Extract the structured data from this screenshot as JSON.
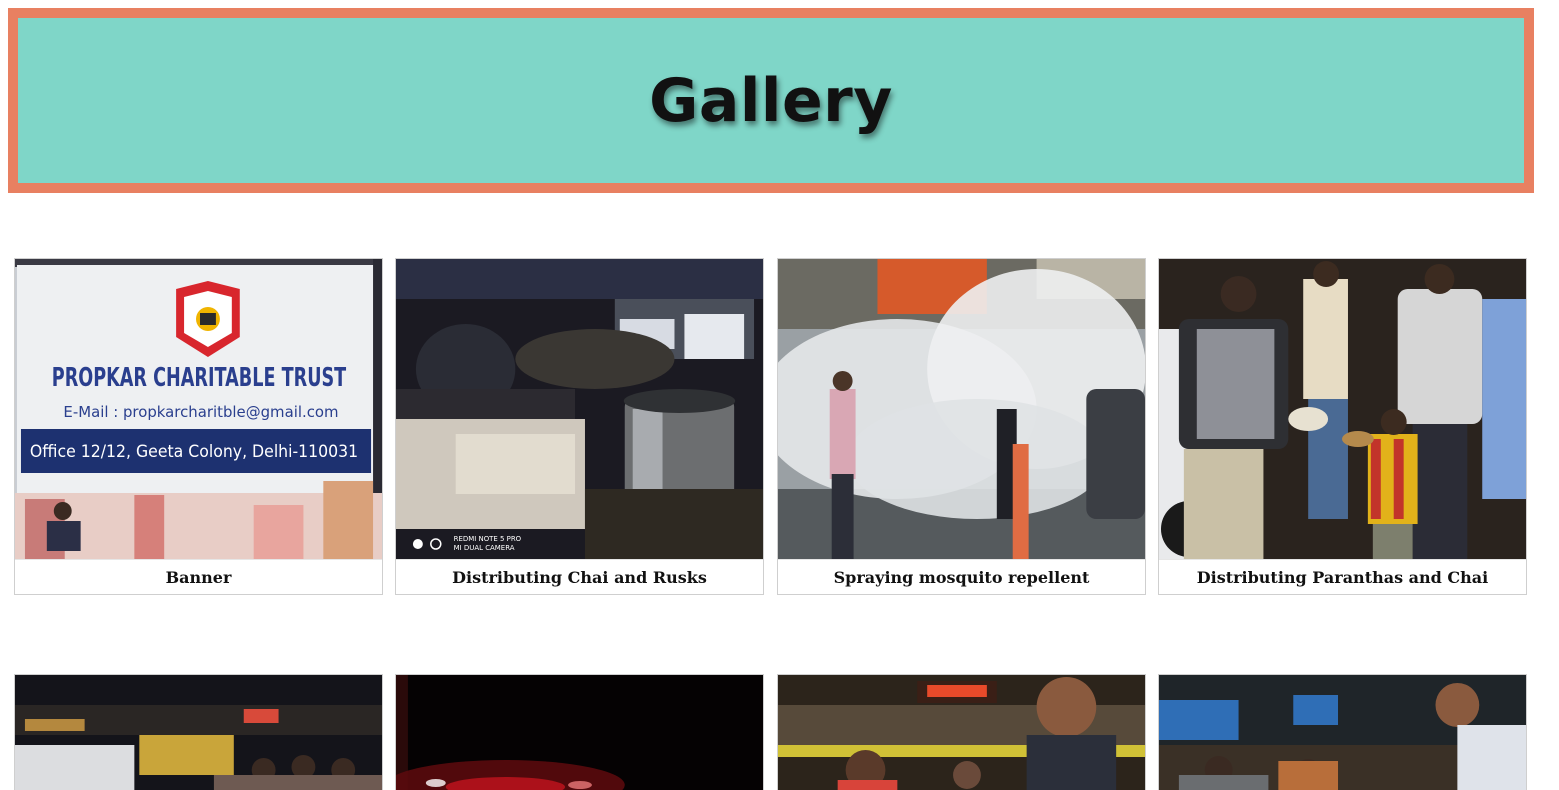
{
  "header": {
    "title": "Gallery"
  },
  "banner_photo": {
    "trust_name": "PROPKAR CHARITABLE TRUST",
    "email": "E-Mail : propkarcharitble@gmail.com",
    "office": "Office 12/12, Geeta Colony, Delhi-110031"
  },
  "chai_photo": {
    "watermark_line1": "REDMI NOTE 5 PRO",
    "watermark_line2": "MI DUAL CAMERA"
  },
  "gallery": [
    {
      "caption": "Banner"
    },
    {
      "caption": "Distributing Chai and Rusks"
    },
    {
      "caption": "Spraying mosquito repellent"
    },
    {
      "caption": "Distributing Paranthas and Chai"
    }
  ]
}
